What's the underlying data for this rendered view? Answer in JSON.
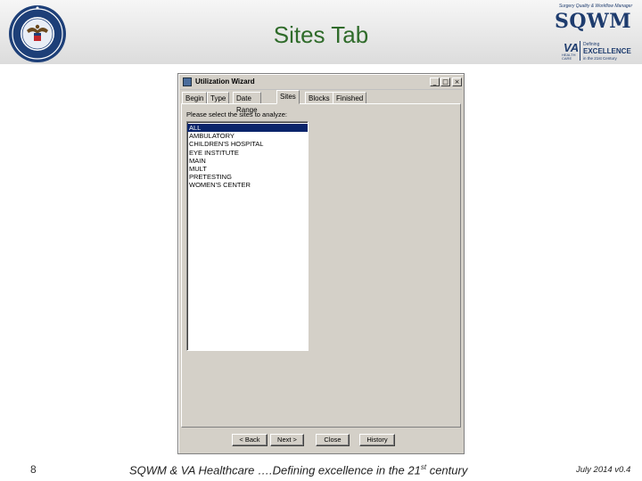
{
  "slide": {
    "title": "Sites Tab",
    "page_number": "8",
    "footer_pre": "SQWM & VA Healthcare ….Defining excellence in the 21",
    "footer_sup": "st",
    "footer_post": " century",
    "version": "July 2014 v0.4"
  },
  "logo": {
    "tagline": "Surgery Quality & Workflow Manager",
    "name": "SQWM",
    "va": "VA",
    "health_care": "HEALTH CARE",
    "defining": "Defining",
    "excellence": "EXCELLENCE",
    "century": "in the 21st Century"
  },
  "window": {
    "title": "Utilization Wizard",
    "controls": {
      "minimize": "_",
      "maximize": "□",
      "close": "×"
    },
    "tabs": [
      "Begin",
      "Type",
      "Date Range",
      "Sites",
      "Blocks",
      "Finished"
    ],
    "active_tab": "Sites",
    "prompt": "Please select the sites to analyze:",
    "sites": [
      "ALL",
      "AMBULATORY",
      "CHILDREN'S HOSPITAL",
      "EYE INSTITUTE",
      "MAIN",
      "MULT",
      "PRETESTING",
      "WOMEN'S CENTER"
    ],
    "selected_site": "ALL",
    "buttons": {
      "back": "< Back",
      "next": "Next >",
      "close": "Close",
      "history": "History"
    }
  },
  "colors": {
    "title_green": "#2f6b2a",
    "logo_navy": "#1e3c6e",
    "selection": "#0a246a"
  }
}
